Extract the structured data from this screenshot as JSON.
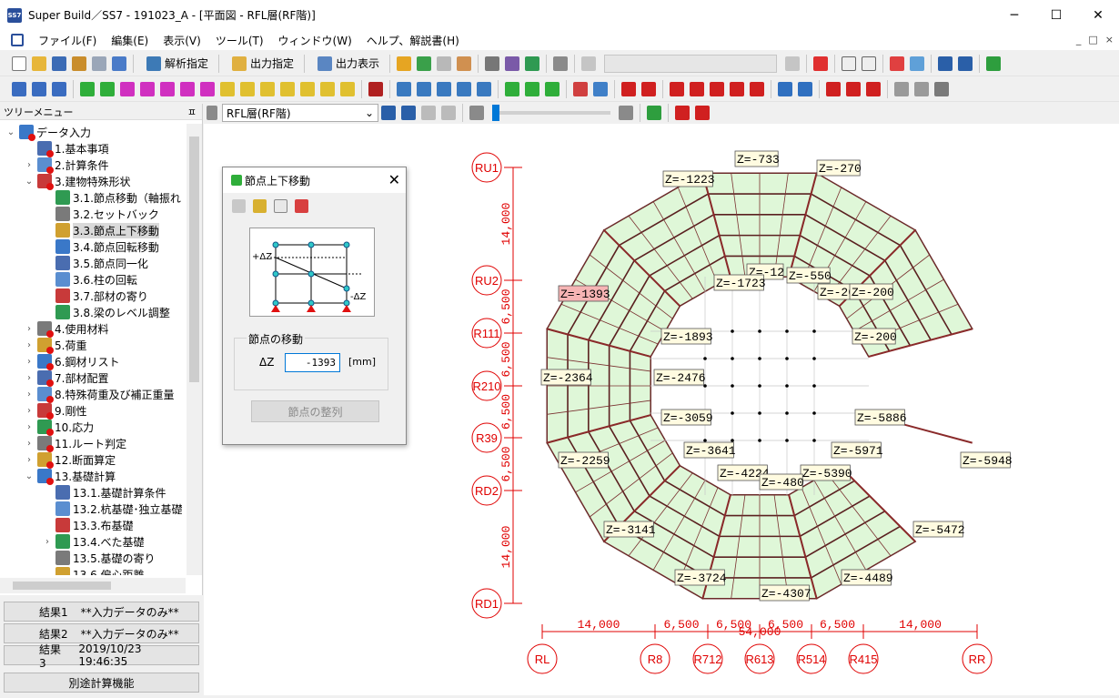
{
  "window": {
    "title": "Super Build／SS7 - 191023_A - [平面図 - RFL層(RF階)]",
    "app_icon": "SS7",
    "controls": [
      "─",
      "☐",
      "✕"
    ]
  },
  "menu": [
    "ファイル(F)",
    "編集(E)",
    "表示(V)",
    "ツール(T)",
    "ウィンドウ(W)",
    "ヘルプ、解説書(H)"
  ],
  "mdi_controls": [
    "_",
    "□",
    "×"
  ],
  "toolbar1": {
    "analysis_spec": "解析指定",
    "output_spec": "出力指定",
    "output_view": "出力表示"
  },
  "tree": {
    "header": "ツリーメニュー",
    "pin": "ㅍ",
    "items": [
      {
        "label": "データ入力",
        "level": 0,
        "expander": "⌄",
        "icon": "data-input-icon"
      },
      {
        "label": "1.基本事項",
        "level": 1,
        "expander": "",
        "icon": "basic-items-icon"
      },
      {
        "label": "2.計算条件",
        "level": 1,
        "expander": "›",
        "icon": "calc-conditions-icon"
      },
      {
        "label": "3.建物特殊形状",
        "level": 1,
        "expander": "⌄",
        "icon": "special-shape-icon"
      },
      {
        "label": "3.1.節点移動（軸振れ",
        "level": 2,
        "expander": "",
        "icon": "node-move-icon"
      },
      {
        "label": "3.2.セットバック",
        "level": 2,
        "expander": "",
        "icon": "setback-icon"
      },
      {
        "label": "3.3.節点上下移動",
        "level": 2,
        "expander": "",
        "icon": "node-vertical-move-icon",
        "selected": true
      },
      {
        "label": "3.4.節点回転移動",
        "level": 2,
        "expander": "",
        "icon": "node-rotate-icon"
      },
      {
        "label": "3.5.節点同一化",
        "level": 2,
        "expander": "",
        "icon": "node-merge-icon"
      },
      {
        "label": "3.6.柱の回転",
        "level": 2,
        "expander": "",
        "icon": "column-rotate-icon"
      },
      {
        "label": "3.7.部材の寄り",
        "level": 2,
        "expander": "",
        "icon": "member-offset-icon"
      },
      {
        "label": "3.8.梁のレベル調整",
        "level": 2,
        "expander": "",
        "icon": "beam-level-icon"
      },
      {
        "label": "4.使用材料",
        "level": 1,
        "expander": "›",
        "icon": "materials-icon"
      },
      {
        "label": "5.荷重",
        "level": 1,
        "expander": "›",
        "icon": "loads-icon"
      },
      {
        "label": "6.鋼材リスト",
        "level": 1,
        "expander": "›",
        "icon": "steel-list-icon"
      },
      {
        "label": "7.部材配置",
        "level": 1,
        "expander": "›",
        "icon": "member-layout-icon"
      },
      {
        "label": "8.特殊荷重及び補正重量",
        "level": 1,
        "expander": "›",
        "icon": "special-load-icon"
      },
      {
        "label": "9.剛性",
        "level": 1,
        "expander": "›",
        "icon": "stiffness-icon"
      },
      {
        "label": "10.応力",
        "level": 1,
        "expander": "›",
        "icon": "stress-icon"
      },
      {
        "label": "11.ルート判定",
        "level": 1,
        "expander": "›",
        "icon": "route-icon"
      },
      {
        "label": "12.断面算定",
        "level": 1,
        "expander": "›",
        "icon": "section-icon"
      },
      {
        "label": "13.基礎計算",
        "level": 1,
        "expander": "⌄",
        "icon": "foundation-icon"
      },
      {
        "label": "13.1.基礎計算条件",
        "level": 2,
        "expander": "",
        "icon": "foundation-cond-icon"
      },
      {
        "label": "13.2.杭基礎･独立基礎",
        "level": 2,
        "expander": "",
        "icon": "pile-icon"
      },
      {
        "label": "13.3.布基礎",
        "level": 2,
        "expander": "",
        "icon": "strip-footing-icon"
      },
      {
        "label": "13.4.べた基礎",
        "level": 2,
        "expander": "›",
        "icon": "mat-foundation-icon"
      },
      {
        "label": "13.5.基礎の寄り",
        "level": 2,
        "expander": "",
        "icon": "foundation-offset-icon"
      },
      {
        "label": "13.6.偏心距離",
        "level": 2,
        "expander": "",
        "icon": "eccentricity-icon"
      }
    ]
  },
  "results": [
    {
      "label": "結果1",
      "value": "**入力データのみ**"
    },
    {
      "label": "結果2",
      "value": "**入力データのみ**"
    },
    {
      "label": "結果3",
      "value": "2019/10/23 19:46:35"
    }
  ],
  "separate_calc": "別途計算機能",
  "layer": "RFL層(RF階)",
  "dialog": {
    "title": "節点上下移動",
    "diag_plus": "+ΔZ",
    "diag_minus": "-ΔZ",
    "group": "節点の移動",
    "dz_label": "ΔZ",
    "dz_value": "-1393",
    "unit": "[mm]",
    "align_button": "節点の整列"
  },
  "plan": {
    "y_axes": [
      "RU1",
      "RU2",
      "R111",
      "R210",
      "R39",
      "RD2",
      "RD1"
    ],
    "y_dims": [
      "14,000",
      "6,500",
      "6,500",
      "6,500",
      "6,500",
      "14,000"
    ],
    "x_axes": [
      "RL",
      "R8",
      "R712",
      "R613",
      "R514",
      "R415",
      "RR"
    ],
    "x_dims": [
      "14,000",
      "6,500",
      "6,500",
      "6,500",
      "6,500",
      "14,000"
    ],
    "x_total": "54,000",
    "z_labels": [
      "Z=-733",
      "Z=-270",
      "Z=-1223",
      "Z=-12",
      "Z=-550",
      "Z=-1723",
      "Z=-200",
      "Z=-200",
      "Z=-1393",
      "Z=-1893",
      "Z=-200",
      "Z=-2364",
      "Z=-2476",
      "Z=-3059",
      "Z=-5886",
      "Z=-3641",
      "Z=-5971",
      "Z=-2259",
      "Z=-5948",
      "Z=-4224",
      "Z=-5390",
      "Z=-480",
      "Z=-3141",
      "Z=-5472",
      "Z=-3724",
      "Z=-4489",
      "Z=-4307"
    ]
  }
}
